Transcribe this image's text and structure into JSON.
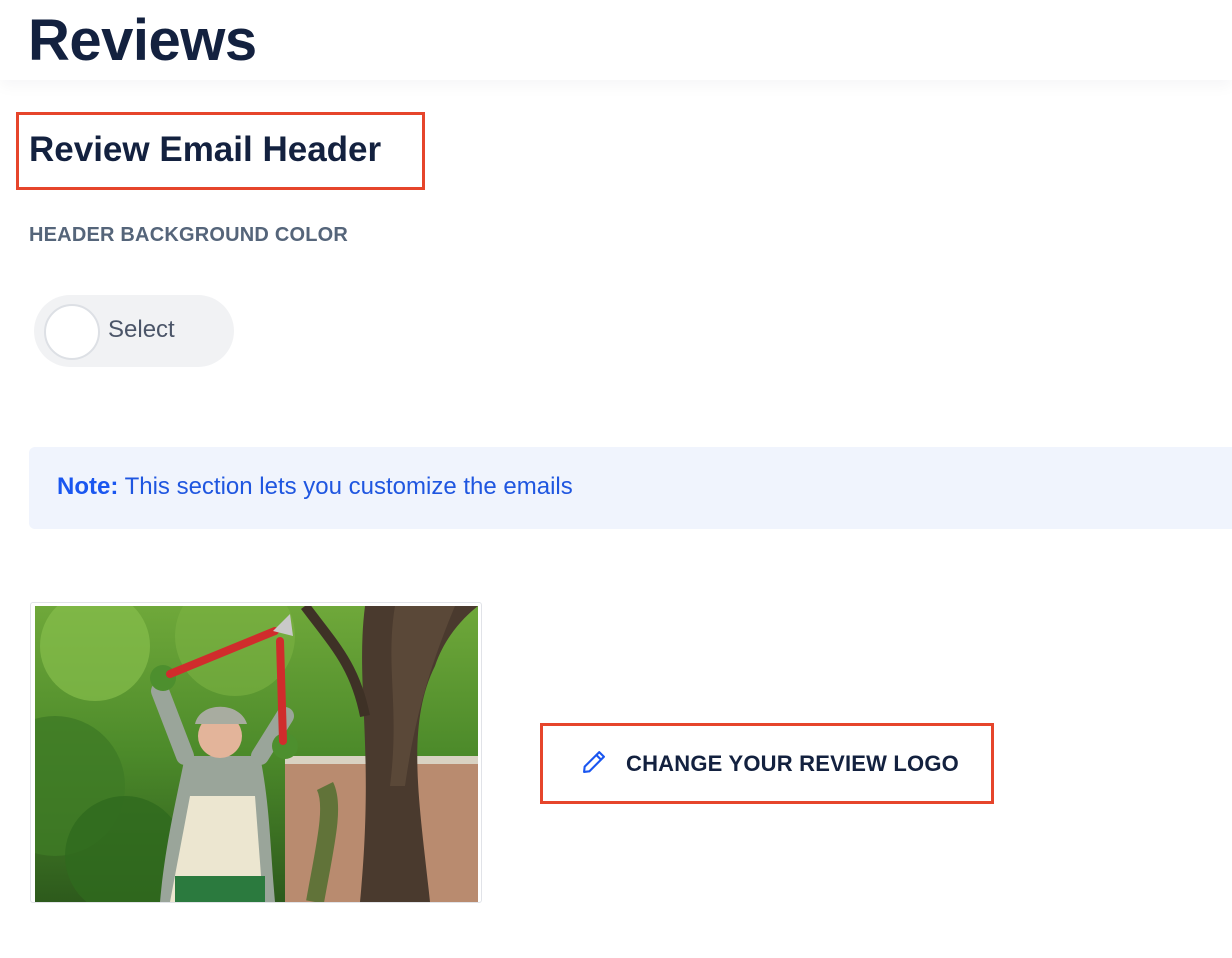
{
  "page": {
    "title": "Reviews"
  },
  "section": {
    "title": "Review Email Header"
  },
  "header_background": {
    "label": "HEADER BACKGROUND COLOR",
    "select_text": "Select"
  },
  "note": {
    "label": "Note:",
    "text": " This section lets you customize the emails"
  },
  "logo": {
    "image_icon": "review-logo-photo",
    "button_label": "CHANGE YOUR REVIEW LOGO",
    "button_icon": "pencil-icon"
  },
  "colors": {
    "title": "#13213f",
    "highlight": "#e6452b",
    "note_bg": "#f0f4fd",
    "note_text": "#1f56e0"
  }
}
